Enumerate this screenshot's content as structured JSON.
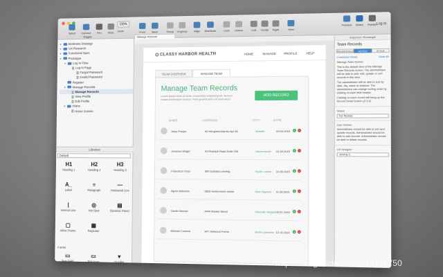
{
  "toolbar": {
    "select": "Select",
    "connect": "Connect",
    "pen": "Pen",
    "more": "More",
    "zoom": "100%",
    "zoom_label": "Zoom",
    "front": "Front",
    "back": "Back",
    "group": "Group",
    "ungroup": "Ungroup",
    "align": "Align",
    "distribute": "Distribute",
    "lock": "Lock",
    "unlock": "Unlock",
    "left": "Left",
    "center": "Center",
    "right": "Right",
    "view": "View",
    "preview": "Preview",
    "share": "Share",
    "publish": "Publish",
    "login": "Log In"
  },
  "pages": {
    "title": "Pages",
    "items": [
      {
        "label": "Business Strategy",
        "type": "folder",
        "indent": 0,
        "arrow": "▸",
        "selected": false
      },
      {
        "label": "UX Research",
        "type": "folder",
        "indent": 0,
        "arrow": "▸",
        "selected": false
      },
      {
        "label": "Functional Spec",
        "type": "folder",
        "indent": 0,
        "arrow": "▸",
        "selected": false
      },
      {
        "label": "Prototype",
        "type": "folder",
        "indent": 0,
        "arrow": "▾",
        "selected": false
      },
      {
        "label": "Log In Flow",
        "type": "folder",
        "indent": 1,
        "arrow": "▾",
        "selected": false
      },
      {
        "label": "Log In Page",
        "type": "page",
        "indent": 2,
        "arrow": "",
        "selected": false
      },
      {
        "label": "Forgot Password",
        "type": "page",
        "indent": 3,
        "arrow": "",
        "selected": false
      },
      {
        "label": "Invalid Password",
        "type": "page",
        "indent": 3,
        "arrow": "",
        "selected": false
      },
      {
        "label": "Register",
        "type": "folder",
        "indent": 1,
        "arrow": "",
        "selected": false
      },
      {
        "label": "Manage Records",
        "type": "folder",
        "indent": 1,
        "arrow": "▾",
        "selected": false
      },
      {
        "label": "Manage Records",
        "type": "page",
        "indent": 2,
        "arrow": "",
        "selected": true
      },
      {
        "label": "View Profile",
        "type": "page",
        "indent": 2,
        "arrow": "",
        "selected": false
      },
      {
        "label": "Edit Profile",
        "type": "page",
        "indent": 2,
        "arrow": "",
        "selected": false
      },
      {
        "label": "Home",
        "type": "folder",
        "indent": 1,
        "arrow": "▾",
        "selected": false
      },
      {
        "label": "Home Screen",
        "type": "page",
        "indent": 2,
        "arrow": "",
        "selected": false
      }
    ]
  },
  "libraries": {
    "title": "Libraries",
    "selected": "Default",
    "widgets": [
      {
        "icon": "H1",
        "label": "Heading 1",
        "icon_name": "heading1-icon"
      },
      {
        "icon": "H2",
        "label": "Heading 2",
        "icon_name": "heading2-icon"
      },
      {
        "icon": "H3",
        "label": "Heading 3",
        "icon_name": "heading3-icon"
      },
      {
        "icon": "A_",
        "label": "Label",
        "icon_name": "label-icon"
      },
      {
        "icon": "≡",
        "label": "Paragraph",
        "icon_name": "paragraph-icon"
      },
      {
        "icon": "—",
        "label": "Horizontal Line",
        "icon_name": "horizontal-line-icon"
      },
      {
        "icon": "|",
        "label": "Vertical Line",
        "icon_name": "vertical-line-icon"
      },
      {
        "icon": "◎",
        "label": "Hot Spot",
        "icon_name": "hot-spot-icon"
      },
      {
        "icon": "▤",
        "label": "Dynamic Panel",
        "icon_name": "dynamic-panel-icon"
      },
      {
        "icon": "▢",
        "label": "Inline Frame",
        "icon_name": "inline-frame-icon"
      },
      {
        "icon": "▦",
        "label": "Repeater",
        "icon_name": "repeater-icon"
      },
      {
        "icon": "",
        "label": "",
        "icon_name": ""
      }
    ],
    "forms_title": "Forms",
    "form_widgets": [
      {
        "icon": "▭",
        "label": "Text Field",
        "icon_name": "text-field-icon"
      },
      {
        "icon": "▭",
        "label": "Text Area",
        "icon_name": "text-area-icon"
      },
      {
        "icon": "▾",
        "label": "Droplist",
        "icon_name": "droplist-icon"
      }
    ]
  },
  "document_tab": "Manage Records",
  "mockup": {
    "brand": "CLASSY HARBOR HEALTH",
    "nav": [
      "HOME",
      "MANAGE",
      "PROFILE",
      "HELP"
    ],
    "tabs": [
      "TEAM OVERVIEW",
      "MANAGE TEAM"
    ],
    "title": "Manage Team Records",
    "subtitle": "Lorem ipsum dolor sit amet, consectetur adipiscing elit. Aenean euismod bibendum laoreet. Proin gravida dolor sit amet lacus.",
    "add_button": "ADD RECORD",
    "columns": [
      "NAME",
      "ADDRESS",
      "CITY",
      "DATE"
    ],
    "rows": [
      {
        "name": "Mary Phelps",
        "address": "83 Wingland Alarms Apt 2A",
        "city": "Bellville",
        "date": "03.03.2016"
      },
      {
        "name": "Johanna Wright",
        "address": "94 Rudolph Road Suite 294",
        "city": "Havenmouth",
        "date": "12.18.2015"
      },
      {
        "name": "Francisco Cross",
        "address": "854 Schulist Landing",
        "city": "South Lowell",
        "date": "10.28.2015"
      },
      {
        "name": "Agnes Martinez",
        "address": "6829 Heidenreich Island",
        "city": "New Skylane",
        "date": "11.09.2015"
      },
      {
        "name": "Daniel Mendel",
        "address": "4444 Market Street",
        "city": "Marcelle Heights",
        "date": "05.01.2015"
      },
      {
        "name": "Michael Cowens",
        "address": "347 Jedwood Forme",
        "city": "North Lakeview",
        "date": "12.13.2014"
      }
    ]
  },
  "inspector": {
    "header": "Inspector: Rectangle",
    "title": "Team Records",
    "tabs": [
      "PROPERTIES",
      "NOTES",
      "STYLE"
    ],
    "active_tab": "NOTES",
    "customize": "Customize Fields",
    "clear": "Clear All",
    "section": "Manage Team Screen",
    "note1": "This is the default view of the Manage Team Records screen. The administrator will be able to add, edit, update or sort records in this view.",
    "note2": "The administrator will be able to sort by date, city, name or address. The administrator can change sorting order by clicking on each field header.",
    "note3": "Clicking on each record will bring up the Record Detail Screen (2.3.2).",
    "status_label": "Status",
    "status_value": "For Review",
    "user_stories_label": "User Stories",
    "user_stories": "Administrator should be able to sort and update records. Administrator should be able to add records. Administrator should be able to delete records.",
    "ux_designer_label": "UX Designer",
    "ux_designer_value": "Jeremy C."
  },
  "watermark": "https://blog.csdn.net/u010711750",
  "colors": {
    "accent_green": "#4cc27a",
    "title_green": "#4ab074",
    "delete_red": "#d54a43",
    "folder_blue": "#4a86c5"
  }
}
